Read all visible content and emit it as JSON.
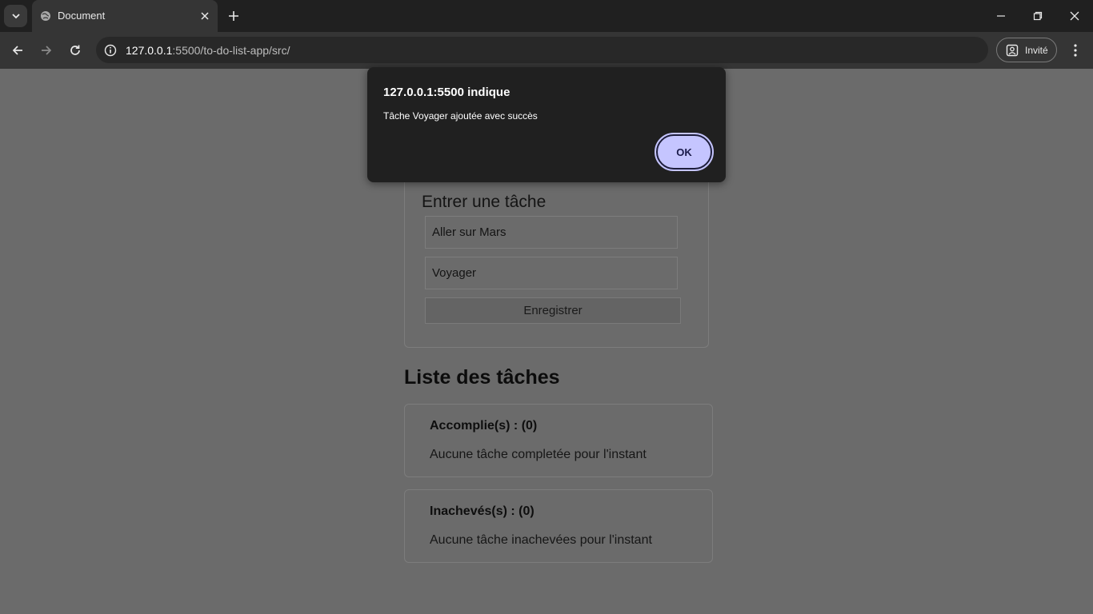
{
  "browser": {
    "tab": {
      "title": "Document"
    },
    "address_bar": {
      "host": "127.0.0.1",
      "path": ":5500/to-do-list-app/src/"
    },
    "profile_label": "Invité"
  },
  "form": {
    "title": "Entrer une tâche",
    "fields": [
      {
        "value": "Aller sur Mars"
      },
      {
        "value": "Voyager"
      }
    ],
    "submit_label": "Enregistrer"
  },
  "task_list": {
    "title": "Liste des tâches",
    "sections": [
      {
        "title": "Accomplie(s) : (0)",
        "empty_message": "Aucune tâche completée pour l'instant"
      },
      {
        "title": "Inachevés(s) : (0)",
        "empty_message": "Aucune tâche inachevées pour l'instant"
      }
    ]
  },
  "dialog": {
    "title": "127.0.0.1:5500 indique",
    "message": "Tâche Voyager ajoutée avec succès",
    "ok_label": "OK"
  },
  "colors": {
    "page_dim": "#6b6b6b",
    "dialog_bg": "#202020",
    "ok_button": "#c5c5ff"
  },
  "icons": [
    "chevron-down-icon",
    "globe-icon",
    "close-icon",
    "plus-icon",
    "minimize-icon",
    "restore-icon",
    "back-arrow-icon",
    "forward-arrow-icon",
    "reload-icon",
    "info-icon",
    "profile-icon",
    "kebab-menu-icon"
  ]
}
